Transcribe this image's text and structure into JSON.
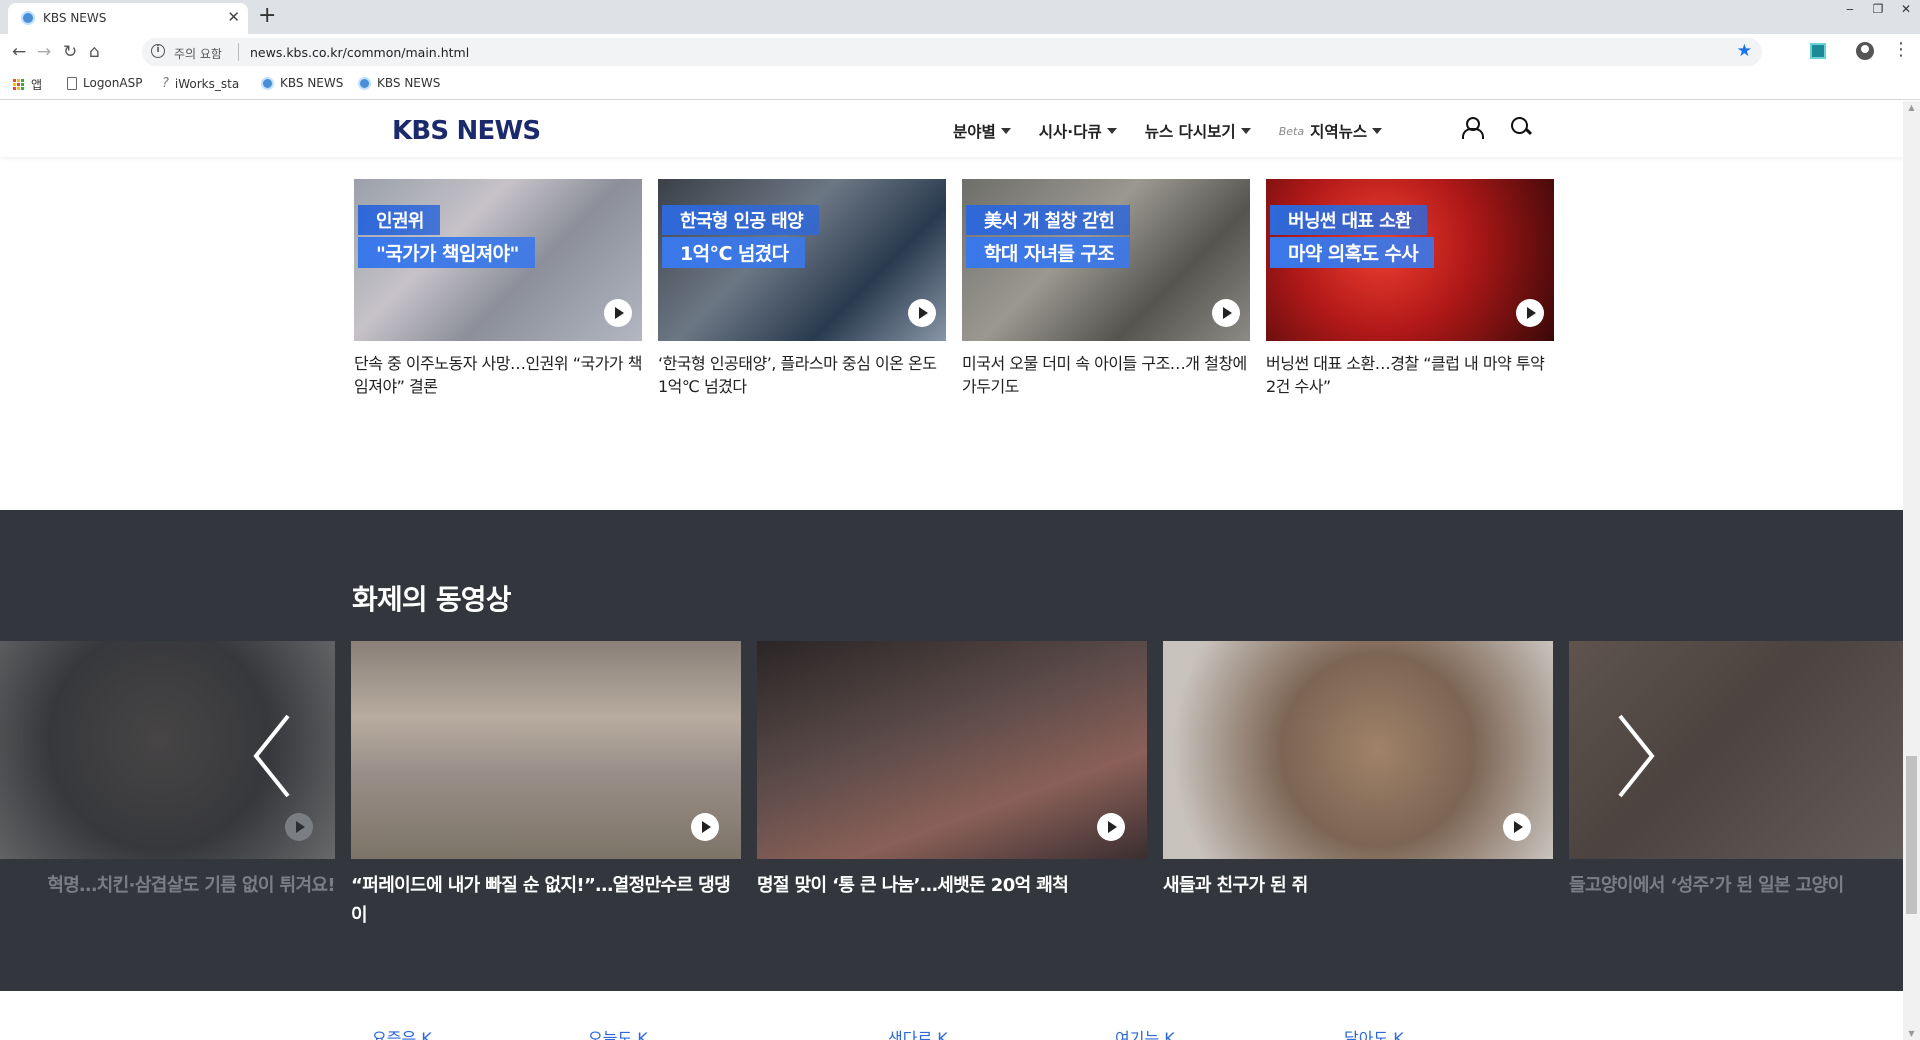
{
  "browser": {
    "tab_title": "KBS NEWS",
    "new_tab": "+",
    "security_label": "주의 요함",
    "url": "news.kbs.co.kr/common/main.html",
    "bookmarks": [
      {
        "label": "앱"
      },
      {
        "label": "LogonASP"
      },
      {
        "label": "iWorks_sta"
      },
      {
        "label": "KBS NEWS"
      },
      {
        "label": "KBS NEWS"
      }
    ]
  },
  "header": {
    "logo": "KBS NEWS",
    "nav": [
      {
        "label": "분야별"
      },
      {
        "label": "시사·다큐"
      },
      {
        "label": "뉴스 다시보기"
      },
      {
        "label": "지역뉴스",
        "badge": "Beta"
      }
    ]
  },
  "news": [
    {
      "cap1": "인권위",
      "cap2": "\"국가가 책임져야\"",
      "title": "단속 중 이주노동자 사망…인권위 “국가가 책임져야” 결론",
      "bg": "linear-gradient(135deg,#9aa0aa 0%,#c6c2c8 35%,#8c8f9a 60%,#b2b7c2 100%)"
    },
    {
      "cap1": "한국형 인공 태양",
      "cap2": "1억℃ 넘겼다",
      "title": "‘한국형 인공태양’, 플라스마 중심 이온 온도 1억℃ 넘겼다",
      "bg": "linear-gradient(135deg,#3b4048 0%,#6c7784 40%,#2a3a4e 70%,#8896a6 100%)"
    },
    {
      "cap1": "美서 개 철창 갇힌",
      "cap2": "학대 자녀들 구조",
      "title": "미국서 오물 더미 속 아이들 구조…개 철창에 가두기도",
      "bg": "linear-gradient(135deg,#6e6e6a 0%,#9a9890 40%,#55544f 70%,#8d8b85 100%)"
    },
    {
      "cap1": "버닝썬 대표 소환",
      "cap2": "마약 의혹도 수사",
      "title": "버닝썬 대표 소환…경찰 “클럽 내 마약 투약 2건 수사”",
      "bg": "radial-gradient(circle at 40% 40%,#f04030 0%,#b01818 45%,#3a0808 100%)"
    }
  ],
  "video_section": {
    "heading": "화제의 동영상",
    "items": [
      {
        "title": "혁명…치킨·삼겹살도 기름 없이 튀겨요!",
        "bg": "radial-gradient(circle at 55% 45%,#6b5e55 0%,#3e3a38 45%,#d7d2cc 90%)"
      },
      {
        "title": "“퍼레이드에 내가 빠질 순 없지!”…열정만수르 댕댕이",
        "bg": "linear-gradient(180deg,#8a8078 0%,#b8aca0 35%,#9a8f88 60%,#7d7468 100%)"
      },
      {
        "title": "명절 맞이 ‘통 큰 나눔’…세뱃돈 20억 쾌척",
        "bg": "linear-gradient(160deg,#2a2526 0%,#5a4a48 40%,#8a6058 70%,#3a2e30 100%)"
      },
      {
        "title": "새들과 친구가 된 쥐",
        "bg": "radial-gradient(circle at 55% 50%,#a08268 0%,#7c6554 40%,#c8c2bc 85%)"
      },
      {
        "title": "들고양이에서 ‘성주’가 된 일본 고양이",
        "bg": "linear-gradient(135deg,#b08a6a 0%,#7a5a44 40%,#c7b09a 100%)"
      }
    ]
  },
  "bottom_links": [
    {
      "label": "요즘은 K"
    },
    {
      "label": "오늘도 K"
    },
    {
      "label": "샌다르 K"
    },
    {
      "label": "여기는 K"
    },
    {
      "label": "달아도 K"
    }
  ],
  "colors": {
    "accent": "#2f68d8",
    "dark_section": "#33373d",
    "logo": "#1b2a6b"
  }
}
